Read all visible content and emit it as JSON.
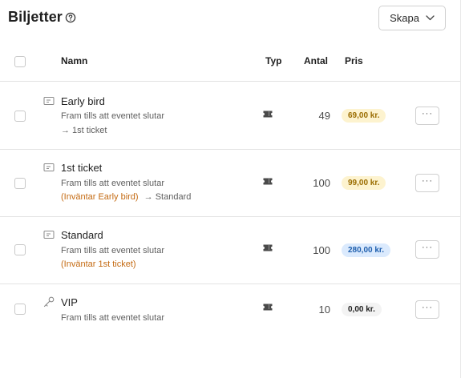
{
  "header": {
    "title": "Biljetter",
    "create_button_label": "Skapa"
  },
  "table": {
    "columns": {
      "name": "Namn",
      "type": "Typ",
      "quantity": "Antal",
      "price": "Pris"
    },
    "more_label": "···",
    "rows": [
      {
        "name": "Early bird",
        "icon": "ticket-outline-icon",
        "subtitle": "Fram tills att eventet slutar",
        "waiting": "",
        "next": "→ 1st ticket",
        "type_icon": "ticket-icon",
        "quantity": "49",
        "price": "69,00 kr.",
        "price_bg": "#fdf3cf",
        "price_color": "#9a6c00"
      },
      {
        "name": "1st ticket",
        "icon": "ticket-outline-icon",
        "subtitle": "Fram tills att eventet slutar",
        "waiting": "(Inväntar Early bird)",
        "next": "→ Standard",
        "type_icon": "ticket-icon",
        "quantity": "100",
        "price": "99,00 kr.",
        "price_bg": "#fdf3cf",
        "price_color": "#9a6c00"
      },
      {
        "name": "Standard",
        "icon": "ticket-outline-icon",
        "subtitle": "Fram tills att eventet slutar",
        "waiting": "(Inväntar 1st ticket)",
        "next": "",
        "type_icon": "ticket-icon",
        "quantity": "100",
        "price": "280,00 kr.",
        "price_bg": "#dbeafd",
        "price_color": "#1f5fae"
      },
      {
        "name": "VIP",
        "icon": "key-icon",
        "subtitle": "Fram tills att eventet slutar",
        "waiting": "",
        "next": "",
        "type_icon": "ticket-icon",
        "quantity": "10",
        "price": "0,00 kr.",
        "price_bg": "#f3f3f3",
        "price_color": "#1f1f1f"
      }
    ]
  }
}
